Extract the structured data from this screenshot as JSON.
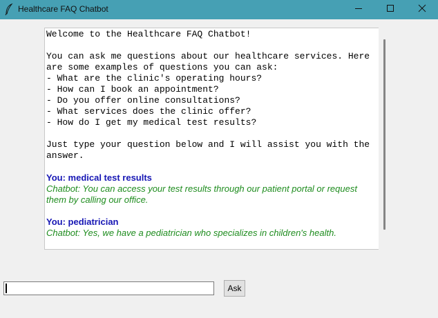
{
  "window": {
    "title": "Healthcare FAQ Chatbot",
    "titlebar_color": "#46a0b4",
    "icon": "feather-icon",
    "controls": [
      "minimize-icon",
      "maximize-icon",
      "close-icon"
    ]
  },
  "chat": {
    "intro_lines": [
      "Welcome to the Healthcare FAQ Chatbot!",
      "",
      "You can ask me questions about our healthcare services. Here",
      "are some examples of questions you can ask:",
      "- What are the clinic's operating hours?",
      "- How can I book an appointment?",
      "- Do you offer online consultations?",
      "- What services does the clinic offer?",
      "- How do I get my medical test results?",
      "",
      "Just type your question below and I will assist you with the",
      "answer."
    ],
    "messages": [
      {
        "you": "You: medical test results",
        "bot": "Chatbot: You can access your test results through our patient portal or request them by calling our office."
      },
      {
        "you": "You: pediatrician",
        "bot": "Chatbot: Yes, we have a pediatrician who specializes in children's health."
      }
    ],
    "you_color": "#1616b4",
    "bot_color": "#1e8c1e"
  },
  "input": {
    "value": "",
    "placeholder": ""
  },
  "ask_button": {
    "label": "Ask"
  }
}
